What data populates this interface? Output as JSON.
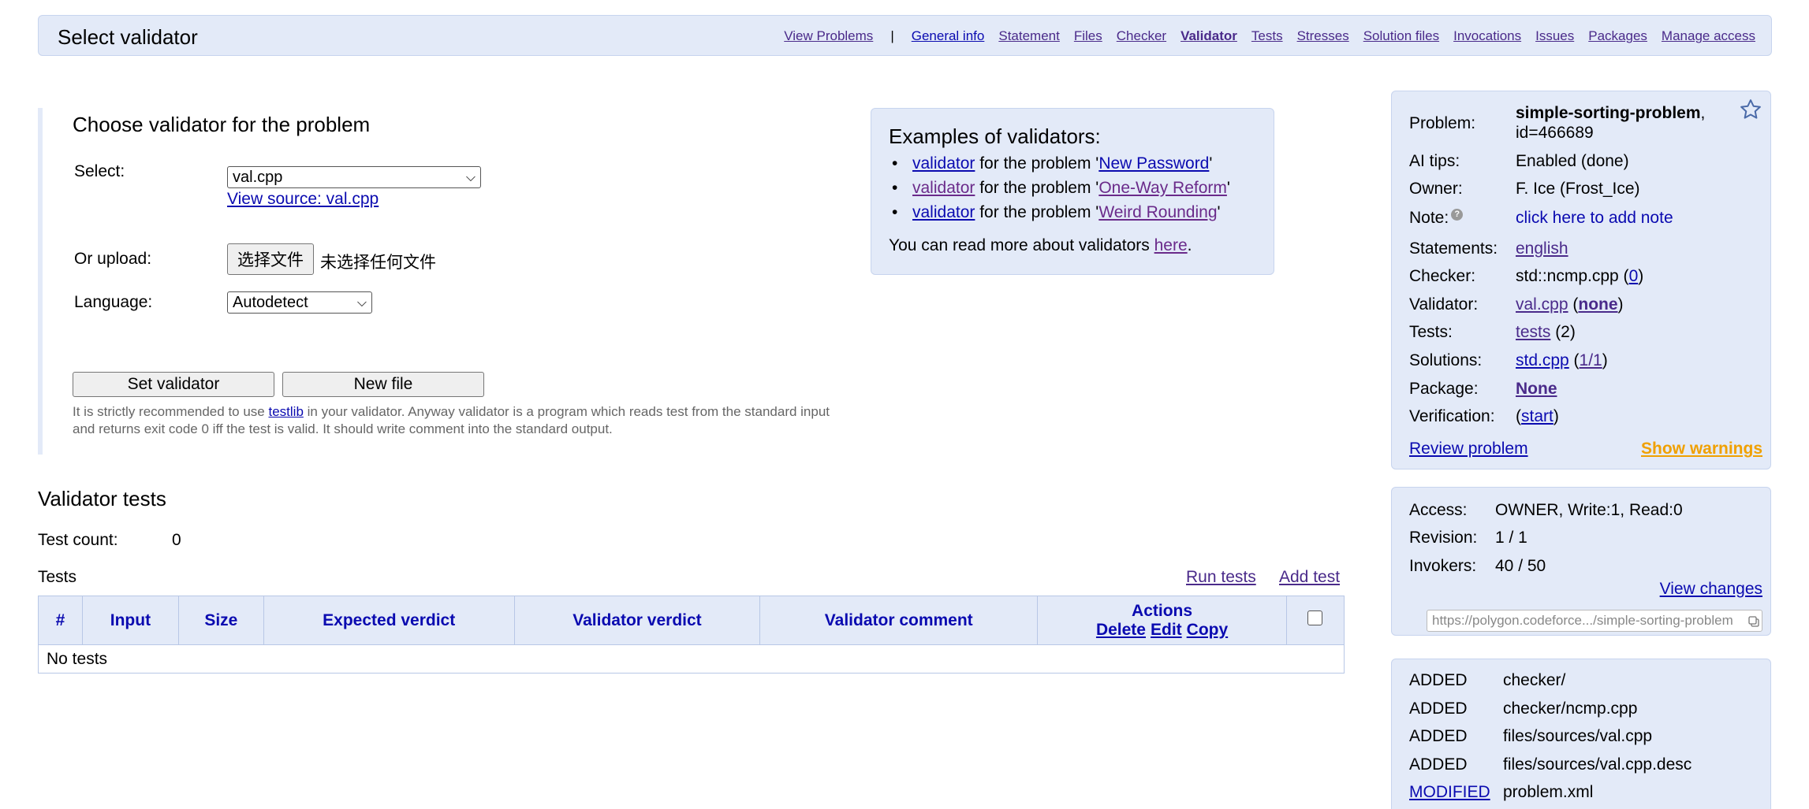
{
  "header": {
    "title": "Select validator",
    "nav": [
      {
        "label": "View Problems"
      },
      {
        "label": "General info"
      },
      {
        "label": "Statement"
      },
      {
        "label": "Files"
      },
      {
        "label": "Checker"
      },
      {
        "label": "Validator",
        "active": true
      },
      {
        "label": "Tests"
      },
      {
        "label": "Stresses"
      },
      {
        "label": "Solution files"
      },
      {
        "label": "Invocations"
      },
      {
        "label": "Issues"
      },
      {
        "label": "Packages"
      },
      {
        "label": "Manage access"
      }
    ],
    "separator": "|"
  },
  "form": {
    "title": "Choose validator for the problem",
    "select_label": "Select:",
    "select_value": "val.cpp",
    "view_source": "View source: val.cpp",
    "upload_label": "Or upload:",
    "file_button": "选择文件",
    "file_status": "未选择任何文件",
    "language_label": "Language:",
    "language_value": "Autodetect",
    "set_button": "Set validator",
    "new_file_button": "New file",
    "note_before": "It is strictly recommended to use ",
    "note_link": "testlib",
    "note_after": " in your validator. Anyway validator is a program which reads test from the standard input and returns exit code 0 iff the test is valid. It should write comment into the standard output."
  },
  "examples": {
    "title": "Examples of validators:",
    "items": [
      {
        "link": "validator",
        "text": " for the problem '",
        "problem": "New Password",
        "end": "'"
      },
      {
        "link": "validator",
        "text": " for the problem '",
        "problem": "One-Way Reform",
        "end": "'"
      },
      {
        "link": "validator",
        "text": " for the problem '",
        "problem": "Weird Rounding",
        "end": "'"
      }
    ],
    "more_text": "You can read more about validators ",
    "more_link": "here",
    "more_end": "."
  },
  "validator_tests": {
    "title": "Validator tests",
    "count_label": "Test count:",
    "count_value": "0",
    "tests_label": "Tests",
    "run_tests": "Run tests",
    "add_test": "Add test",
    "columns": [
      "#",
      "Input",
      "Size",
      "Expected verdict",
      "Validator verdict",
      "Validator comment"
    ],
    "actions_header": "Actions",
    "actions": [
      "Delete",
      "Edit",
      "Copy"
    ],
    "empty_text": "No tests"
  },
  "info": {
    "problem_label": "Problem:",
    "problem_name": "simple-sorting-problem",
    "problem_comma": ",",
    "problem_id": "id=466689",
    "ai_label": "AI tips:",
    "ai_value": "Enabled (done)",
    "owner_label": "Owner:",
    "owner_value": "F. Ice (Frost_Ice)",
    "note_label": "Note:",
    "help_glyph": "?",
    "note_link": "click here to add note",
    "statements_label": "Statements:",
    "statements_link": "english",
    "checker_label": "Checker:",
    "checker_value": "std::ncmp.cpp (",
    "checker_link": "0",
    "checker_end": ")",
    "validator_label": "Validator:",
    "validator_link": "val.cpp",
    "validator_open": " (",
    "validator_status": "none",
    "validator_end": ")",
    "tests_label": "Tests:",
    "tests_link": "tests",
    "tests_count": " (2)",
    "solutions_label": "Solutions:",
    "solutions_link": "std.cpp",
    "solutions_open": " (",
    "solutions_count": "1/1",
    "solutions_end": ")",
    "package_label": "Package:",
    "package_value": "None",
    "verification_label": "Verification:",
    "verification_open": "(",
    "verification_link": "start",
    "verification_end": ")",
    "review_link": "Review problem",
    "warnings_link": "Show warnings"
  },
  "access": {
    "access_label": "Access:",
    "access_value": "OWNER, Write:1, Read:0",
    "revision_label": "Revision:",
    "revision_value": "1 / 1",
    "invokers_label": "Invokers:",
    "invokers_value": "40 / 50",
    "view_changes": "View changes",
    "url": "https://polygon.codeforce.../simple-sorting-problem"
  },
  "changes": [
    {
      "status": "ADDED",
      "path": "checker/"
    },
    {
      "status": "ADDED",
      "path": "checker/ncmp.cpp"
    },
    {
      "status": "ADDED",
      "path": "files/sources/val.cpp"
    },
    {
      "status": "ADDED",
      "path": "files/sources/val.cpp.desc"
    },
    {
      "status": "MODIFIED",
      "path": "problem.xml",
      "link": true
    }
  ],
  "colors": {
    "panel_bg": "#e3eaf8",
    "link": "#0a0ab0",
    "visited": "#6a2a8a",
    "warning": "#f0a000",
    "error": "#e01010"
  }
}
